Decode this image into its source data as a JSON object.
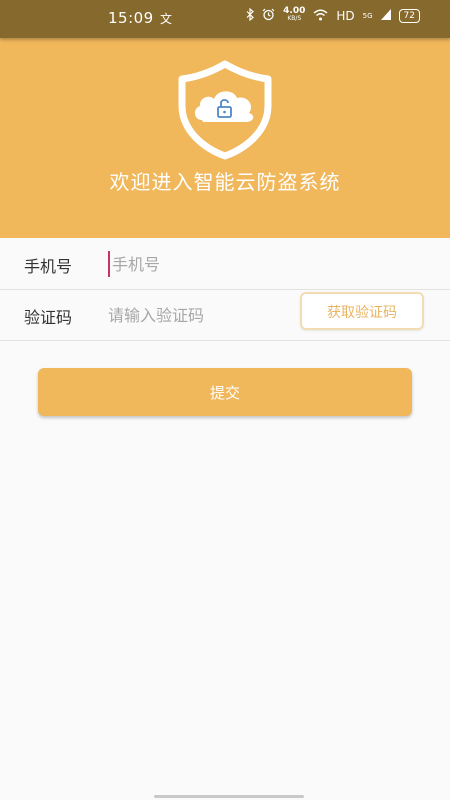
{
  "colors": {
    "status_bar": "#86692c",
    "header": "#f0b75b",
    "accent_text": "#e9b464",
    "lock_icon": "#4f86c6"
  },
  "status_bar": {
    "time": "15:09",
    "ime_indicator": "文",
    "speed_value": "4.00",
    "speed_unit": "KB/S",
    "network_label": "HD",
    "signal_label": "5G",
    "battery_level": "72",
    "icons": [
      "bluetooth-icon",
      "alarm-icon",
      "wifi-icon",
      "signal-icon",
      "battery-icon"
    ]
  },
  "header": {
    "logo_icon": "shield-cloud-lock-icon",
    "title": "欢迎进入智能云防盗系统"
  },
  "form": {
    "phone_label": "手机号",
    "phone_placeholder": "手机号",
    "code_label": "验证码",
    "code_placeholder": "请输入验证码",
    "get_code_button": "获取验证码",
    "submit_button": "提交"
  }
}
